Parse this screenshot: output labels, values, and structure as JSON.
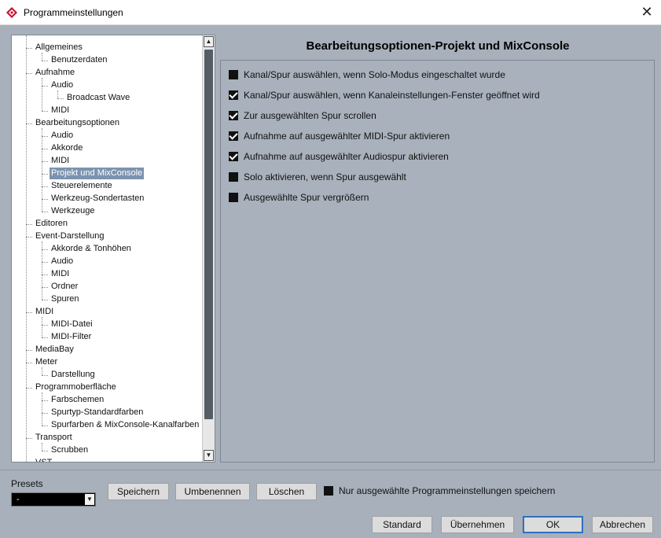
{
  "window": {
    "title": "Programmeinstellungen"
  },
  "tree": {
    "items": [
      {
        "label": "Allgemeines",
        "level": 1
      },
      {
        "label": "Benutzerdaten",
        "level": 2
      },
      {
        "label": "Aufnahme",
        "level": 1
      },
      {
        "label": "Audio",
        "level": 2
      },
      {
        "label": "Broadcast Wave",
        "level": 3
      },
      {
        "label": "MIDI",
        "level": 2
      },
      {
        "label": "Bearbeitungsoptionen",
        "level": 1
      },
      {
        "label": "Audio",
        "level": 2
      },
      {
        "label": "Akkorde",
        "level": 2
      },
      {
        "label": "MIDI",
        "level": 2
      },
      {
        "label": "Projekt und MixConsole",
        "level": 2,
        "selected": true
      },
      {
        "label": "Steuerelemente",
        "level": 2
      },
      {
        "label": "Werkzeug-Sondertasten",
        "level": 2
      },
      {
        "label": "Werkzeuge",
        "level": 2
      },
      {
        "label": "Editoren",
        "level": 1
      },
      {
        "label": "Event-Darstellung",
        "level": 1
      },
      {
        "label": "Akkorde & Tonhöhen",
        "level": 2
      },
      {
        "label": "Audio",
        "level": 2
      },
      {
        "label": "MIDI",
        "level": 2
      },
      {
        "label": "Ordner",
        "level": 2
      },
      {
        "label": "Spuren",
        "level": 2
      },
      {
        "label": "MIDI",
        "level": 1
      },
      {
        "label": "MIDI-Datei",
        "level": 2
      },
      {
        "label": "MIDI-Filter",
        "level": 2
      },
      {
        "label": "MediaBay",
        "level": 1
      },
      {
        "label": "Meter",
        "level": 1
      },
      {
        "label": "Darstellung",
        "level": 2
      },
      {
        "label": "Programmoberfläche",
        "level": 1
      },
      {
        "label": "Farbschemen",
        "level": 2
      },
      {
        "label": "Spurtyp-Standardfarben",
        "level": 2
      },
      {
        "label": "Spurfarben & MixConsole-Kanalfarben",
        "level": 2
      },
      {
        "label": "Transport",
        "level": 1
      },
      {
        "label": "Scrubben",
        "level": 2
      },
      {
        "label": "VST",
        "level": 1
      }
    ]
  },
  "section": {
    "title": "Bearbeitungsoptionen-Projekt und MixConsole"
  },
  "options": [
    {
      "label": "Kanal/Spur auswählen, wenn Solo-Modus eingeschaltet wurde",
      "checked": false
    },
    {
      "label": "Kanal/Spur auswählen, wenn Kanaleinstellungen-Fenster geöffnet wird",
      "checked": true
    },
    {
      "label": "Zur ausgewählten Spur scrollen",
      "checked": true
    },
    {
      "label": "Aufnahme auf ausgewählter MIDI-Spur aktivieren",
      "checked": true
    },
    {
      "label": "Aufnahme auf ausgewählter Audiospur aktivieren",
      "checked": true
    },
    {
      "label": "Solo aktivieren, wenn Spur ausgewählt",
      "checked": false
    },
    {
      "label": "Ausgewählte Spur vergrößern",
      "checked": false
    }
  ],
  "presets": {
    "label": "Presets",
    "value": "-",
    "save": "Speichern",
    "rename": "Umbenennen",
    "delete": "Löschen",
    "save_only_selected": "Nur ausgewählte Programmeinstellungen speichern",
    "save_only_selected_checked": false
  },
  "footer": {
    "standard": "Standard",
    "apply": "Übernehmen",
    "ok": "OK",
    "cancel": "Abbrechen"
  },
  "colors": {
    "background": "#a7b0bb",
    "selection": "#7c93b0",
    "app_icon": "#c8102e"
  },
  "icons": {
    "app": "cubase-logo-icon",
    "close": "close-icon"
  }
}
